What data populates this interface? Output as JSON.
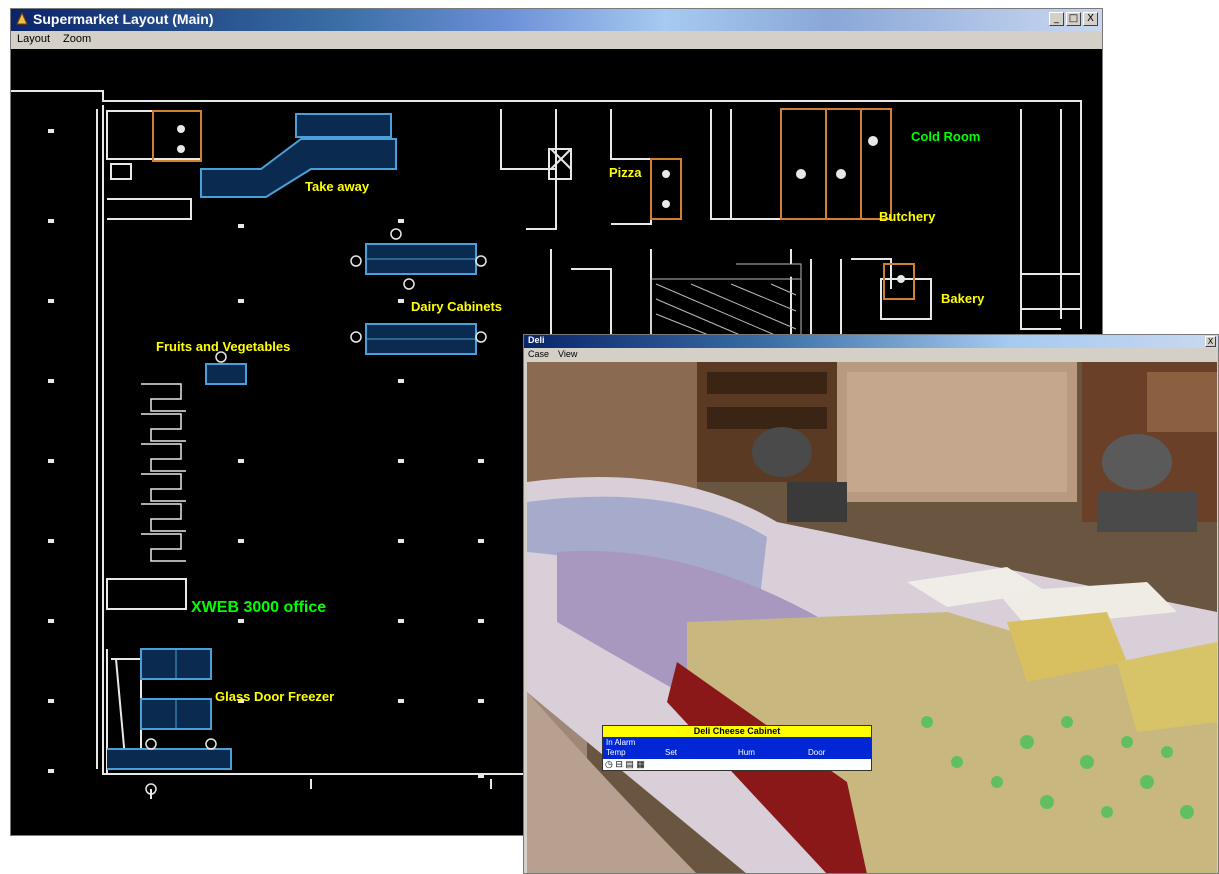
{
  "main_window": {
    "title": "Supermarket Layout (Main)",
    "menu": [
      "Layout",
      "Zoom"
    ],
    "buttons": {
      "minimize": "_",
      "maximize": "□",
      "close": "X"
    },
    "labels": {
      "takeaway": "Take away",
      "pizza": "Pizza",
      "cold_room": "Cold Room",
      "butchery": "Butchery",
      "dairy": "Dairy Cabinets",
      "bakery": "Bakery",
      "fruits": "Fruits and Vegetables",
      "office": "XWEB 3000 office",
      "freezer": "Glass Door Freezer"
    },
    "label_colors": {
      "yellow": "#ffff00",
      "green": "#00ff00"
    }
  },
  "photo_window": {
    "title": "Deli",
    "menu": [
      "Case",
      "View"
    ],
    "buttons": {
      "close": "X"
    },
    "status_panel": {
      "title": "Deli Cheese Cabinet",
      "row1": "In Alarm",
      "row2": [
        "Temp",
        "Set",
        "Hum",
        "Door"
      ],
      "footer": "◷ ⊟ ▤ ▦"
    }
  }
}
